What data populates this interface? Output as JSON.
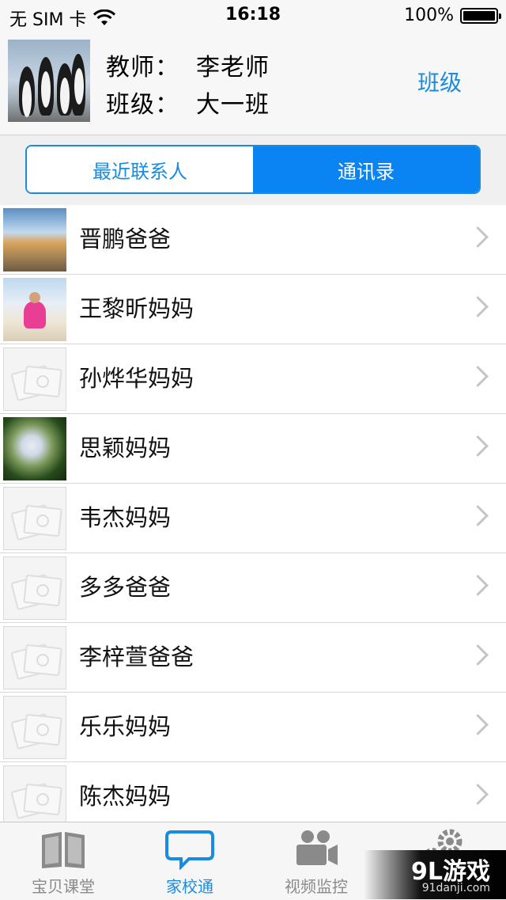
{
  "status_bar": {
    "carrier": "无 SIM 卡",
    "time": "16:18",
    "battery": "100%"
  },
  "header": {
    "teacher_label": "教师：",
    "teacher_name": "李老师",
    "class_label": "班级：",
    "class_name": "大一班",
    "class_button": "班级"
  },
  "segments": {
    "recent": "最近联系人",
    "contacts": "通讯录",
    "selected": "通讯录"
  },
  "contacts": [
    {
      "name": "晋鹏爸爸",
      "avatar": "beach-photo"
    },
    {
      "name": "王黎昕妈妈",
      "avatar": "girl-photo"
    },
    {
      "name": "孙烨华妈妈",
      "avatar": "placeholder"
    },
    {
      "name": "思颖妈妈",
      "avatar": "flower-photo"
    },
    {
      "name": "韦杰妈妈",
      "avatar": "placeholder"
    },
    {
      "name": "多多爸爸",
      "avatar": "placeholder"
    },
    {
      "name": "李梓萱爸爸",
      "avatar": "placeholder"
    },
    {
      "name": "乐乐妈妈",
      "avatar": "placeholder"
    },
    {
      "name": "陈杰妈妈",
      "avatar": "placeholder"
    }
  ],
  "tabs": [
    {
      "label": "宝贝课堂",
      "icon": "book-icon"
    },
    {
      "label": "家校通",
      "icon": "chat-bubble-icon"
    },
    {
      "label": "视频监控",
      "icon": "video-camera-icon"
    },
    {
      "label": "",
      "icon": "gear-icon"
    }
  ],
  "active_tab": "家校通",
  "watermark": {
    "main": "9L游戏",
    "sub": "91danji.com"
  },
  "colors": {
    "accent": "#1a8ce0",
    "segment_selected": "#0a84f2",
    "tab_inactive": "#8a8a8a"
  }
}
